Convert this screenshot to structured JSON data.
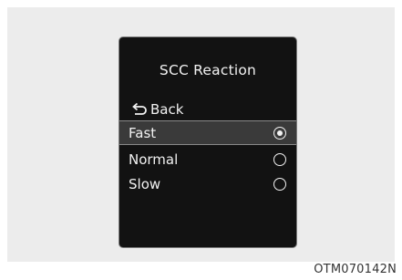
{
  "panel": {
    "title": "SCC Reaction",
    "back_label": "Back",
    "options": [
      {
        "label": "Fast",
        "selected": true
      },
      {
        "label": "Normal",
        "selected": false
      },
      {
        "label": "Slow",
        "selected": false
      }
    ]
  },
  "caption": "OTM070142N",
  "icons": {
    "back": "return-arrow-icon",
    "radio_selected": "radio-selected-icon",
    "radio_unselected": "radio-unselected-icon"
  },
  "colors": {
    "panel_bg": "#121212",
    "selected_row_bg": "#3a3a3a",
    "text": "#f2f2f2",
    "backdrop": "#ececec"
  }
}
